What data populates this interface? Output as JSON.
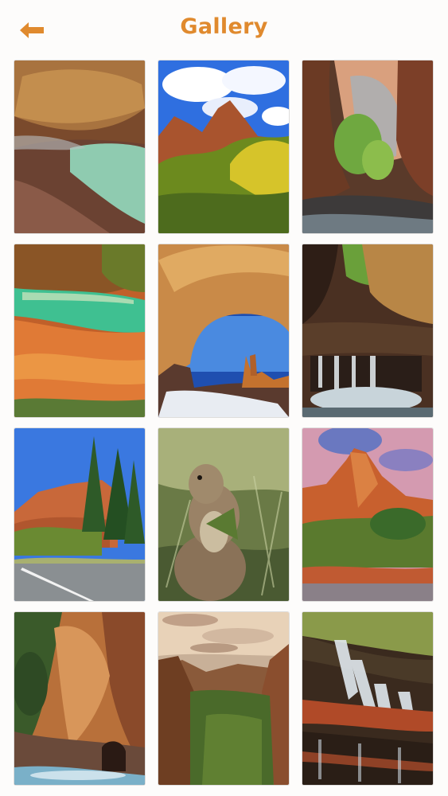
{
  "header": {
    "title": "Gallery",
    "back_icon": "arrow-left-icon",
    "accent_color": "#e08a2e"
  },
  "gallery": {
    "items": [
      {
        "subject": "slot-canyon-green-pool"
      },
      {
        "subject": "red-peaks-autumn-trees-blue-sky"
      },
      {
        "subject": "narrow-canyon-walls-tree"
      },
      {
        "subject": "canyon-turquoise-stream-red-rock"
      },
      {
        "subject": "double-arch-snow"
      },
      {
        "subject": "canyon-waterfall-pool"
      },
      {
        "subject": "red-cliffs-pines-road"
      },
      {
        "subject": "squirrel-eating-grass"
      },
      {
        "subject": "red-peak-sunset-river"
      },
      {
        "subject": "canyon-tunnel-stream"
      },
      {
        "subject": "canyon-valley-overlook"
      },
      {
        "subject": "cascading-waterfall-red-rock"
      }
    ]
  }
}
